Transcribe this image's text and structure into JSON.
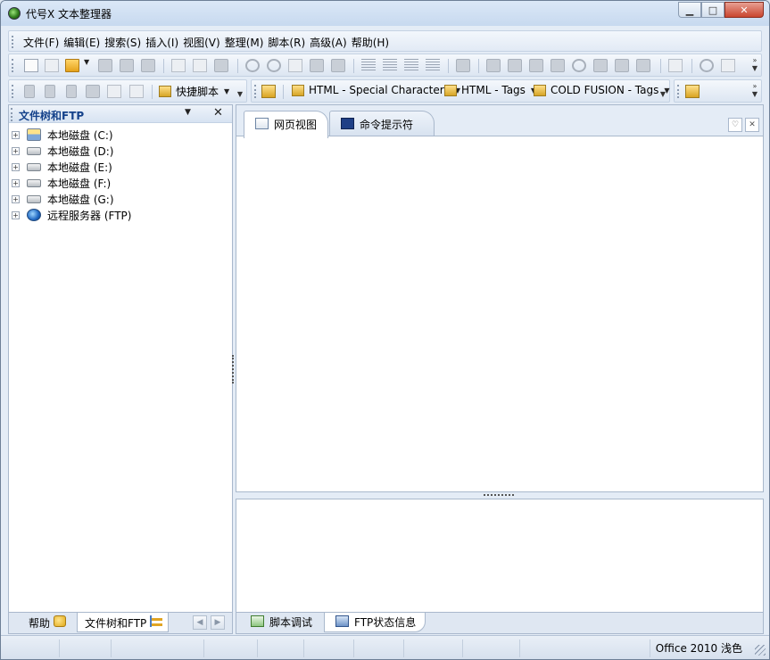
{
  "window": {
    "title": "代号X 文本整理器"
  },
  "menu": [
    "文件(F)",
    "编辑(E)",
    "搜索(S)",
    "插入(I)",
    "视图(V)",
    "整理(M)",
    "脚本(R)",
    "高级(A)",
    "帮助(H)"
  ],
  "toolbar2": {
    "quick_script": "快捷脚本",
    "dd_html_special": "HTML - Special Characters",
    "dd_html_tags": "HTML - Tags",
    "dd_coldfusion": "COLD FUSION - Tags"
  },
  "left_panel": {
    "title": "文件树和FTP",
    "tree": [
      {
        "label": "本地磁盘 (C:)",
        "icon": "system-drive-icon"
      },
      {
        "label": "本地磁盘 (D:)",
        "icon": "drive-icon"
      },
      {
        "label": "本地磁盘 (E:)",
        "icon": "drive-icon"
      },
      {
        "label": "本地磁盘 (F:)",
        "icon": "drive-icon"
      },
      {
        "label": "本地磁盘 (G:)",
        "icon": "drive-icon"
      },
      {
        "label": "远程服务器 (FTP)",
        "icon": "globe-icon"
      }
    ],
    "tabs": {
      "help": "帮助",
      "filetree": "文件树和FTP"
    }
  },
  "editor_tabs": {
    "web_view": "网页视图",
    "cmd_prompt": "命令提示符"
  },
  "lower_tabs": {
    "script_debug": "脚本调试",
    "ftp_status": "FTP状态信息"
  },
  "status": {
    "theme": "Office 2010 浅色"
  }
}
